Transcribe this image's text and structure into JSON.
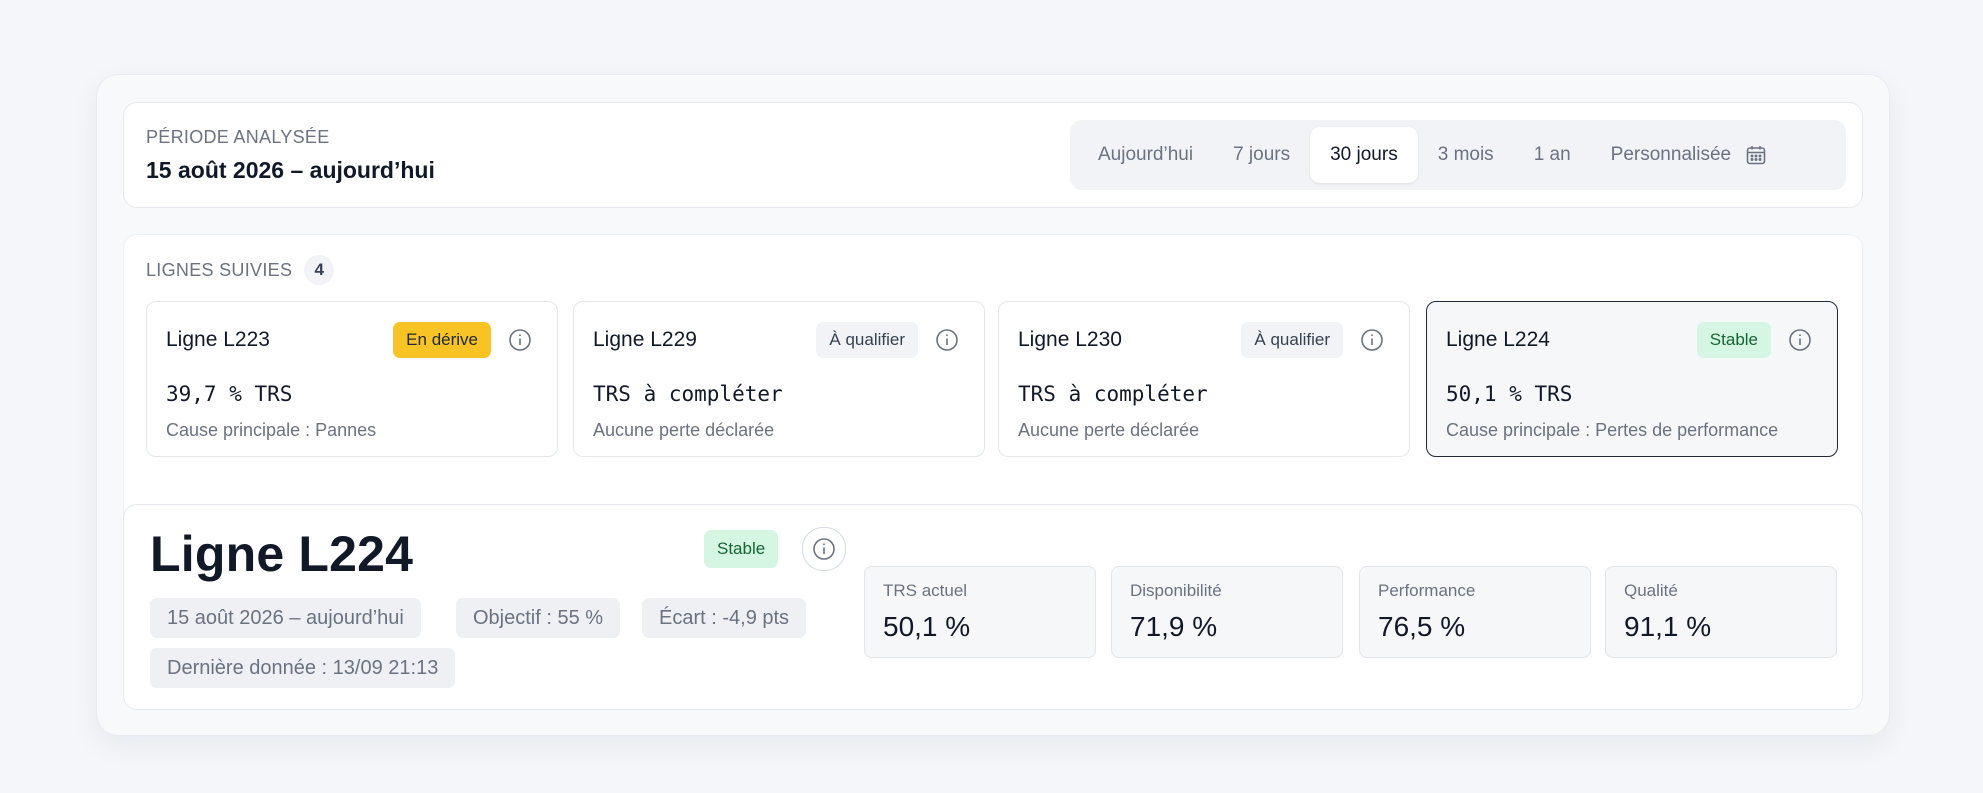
{
  "period": {
    "label": "PÉRIODE ANALYSÉE",
    "value": "15 août 2026 – aujourd’hui",
    "options": [
      "Aujourd’hui",
      "7 jours",
      "30 jours",
      "3 mois",
      "1 an",
      "Personnalisée"
    ],
    "selected": "30 jours",
    "custom_icon": "calendar-icon"
  },
  "lines": {
    "title": "LIGNES SUIVIES",
    "count": "4",
    "items": [
      {
        "name": "Ligne L223",
        "badge": "En dérive",
        "status": "drift",
        "value": "39,7 % TRS",
        "sub": "Cause principale : Pannes"
      },
      {
        "name": "Ligne L229",
        "badge": "À qualifier",
        "status": "qualify",
        "value": "TRS à compléter",
        "sub": "Aucune perte déclarée"
      },
      {
        "name": "Ligne L230",
        "badge": "À qualifier",
        "status": "qualify",
        "value": "TRS à compléter",
        "sub": "Aucune perte déclarée"
      },
      {
        "name": "Ligne L224",
        "badge": "Stable",
        "status": "stable",
        "value": "50,1 % TRS",
        "sub": "Cause principale : Pertes de performance",
        "selected": true
      }
    ]
  },
  "detail": {
    "title": "Ligne L224",
    "badge": "Stable",
    "chips": {
      "period": "15 août 2026 – aujourd’hui",
      "target": "Objectif : 55 %",
      "gap": "Écart : -4,9 pts",
      "last": "Dernière donnée : 13/09 21:13"
    },
    "metrics": [
      {
        "label": "TRS actuel",
        "value": "50,1 %"
      },
      {
        "label": "Disponibilité",
        "value": "71,9 %"
      },
      {
        "label": "Performance",
        "value": "76,5 %"
      },
      {
        "label": "Qualité",
        "value": "91,1 %"
      }
    ]
  },
  "colors": {
    "drift": "#f7c325",
    "qualify": "#f1f3f7",
    "stable": "#d6f6e4",
    "selected_border": "#1f2937"
  }
}
